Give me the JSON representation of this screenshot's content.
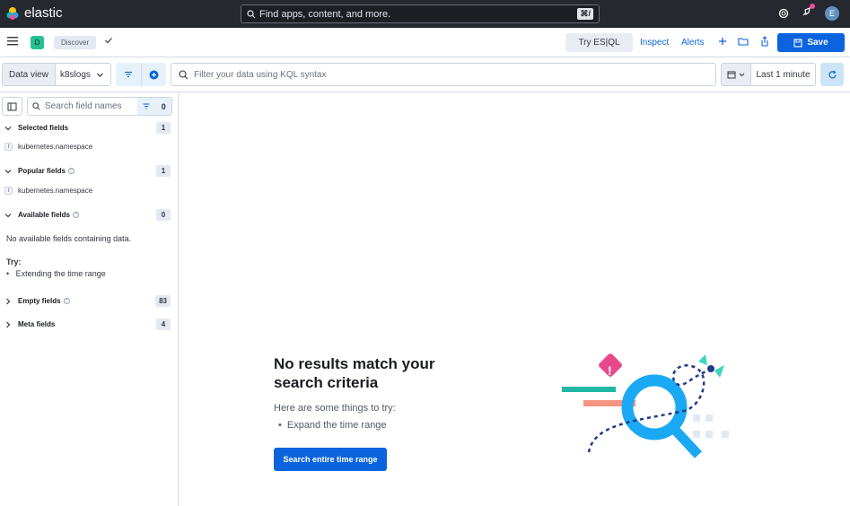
{
  "topbar": {
    "brand": "elastic",
    "search_placeholder": "Find apps, content, and more.",
    "shortcut": "⌘/",
    "avatar_initial": "E"
  },
  "appbar": {
    "space_initial": "D",
    "breadcrumb": "Discover",
    "try_esql": "Try ES|QL",
    "inspect": "Inspect",
    "alerts": "Alerts",
    "save": "Save"
  },
  "querybar": {
    "data_view_label": "Data view",
    "data_view_value": "k8slogs",
    "kql_placeholder": "Filter your data using KQL syntax",
    "time_range": "Last 1 minute"
  },
  "sidebar": {
    "search_placeholder": "Search field names",
    "filter_count": "0",
    "selected": {
      "title": "Selected fields",
      "count": "1",
      "fields": [
        {
          "type": "t",
          "name": "kubernetes.namespace"
        }
      ]
    },
    "popular": {
      "title": "Popular fields",
      "count": "1",
      "fields": [
        {
          "type": "t",
          "name": "kubernetes.namespace"
        }
      ]
    },
    "available": {
      "title": "Available fields",
      "count": "0",
      "empty_msg": "No available fields containing data.",
      "try_label": "Try:",
      "tip": "Extending the time range"
    },
    "empty_fields": {
      "title": "Empty fields",
      "count": "83"
    },
    "meta_fields": {
      "title": "Meta fields",
      "count": "4"
    }
  },
  "main": {
    "title": "No results match your search criteria",
    "subtitle": "Here are some things to try:",
    "tip": "Expand the time range",
    "button": "Search entire time range"
  },
  "colors": {
    "primary": "#0b64dd",
    "topbar": "#25282f",
    "space_badge": "#24c292"
  }
}
